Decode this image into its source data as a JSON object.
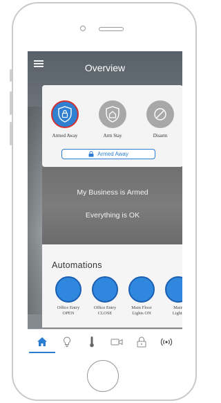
{
  "header": {
    "title": "Overview"
  },
  "security": {
    "modes": [
      {
        "label": "Armed Away",
        "icon": "shield-lock-icon",
        "active": true
      },
      {
        "label": "Arm Stay",
        "icon": "shield-home-icon",
        "active": false
      },
      {
        "label": "Disarm",
        "icon": "disarm-icon",
        "active": false
      }
    ],
    "current_status": "Armed Away"
  },
  "status": {
    "line1": "My Business is Armed",
    "line2": "Everything is OK"
  },
  "automations": {
    "title": "Automations",
    "items": [
      {
        "line1": "Office Entry",
        "line2": "OPEN"
      },
      {
        "line1": "Office Entry",
        "line2": "CLOSE"
      },
      {
        "line1": "Main Floor",
        "line2": "Lights ON"
      },
      {
        "line1": "Main",
        "line2": "Lights"
      }
    ]
  },
  "nav": {
    "items": [
      "home-icon",
      "bulb-icon",
      "thermometer-icon",
      "camera-icon",
      "lock-icon",
      "signal-icon"
    ],
    "active": "home-icon"
  },
  "colors": {
    "accent": "#2a7dd1",
    "alert": "#d32f2f"
  }
}
